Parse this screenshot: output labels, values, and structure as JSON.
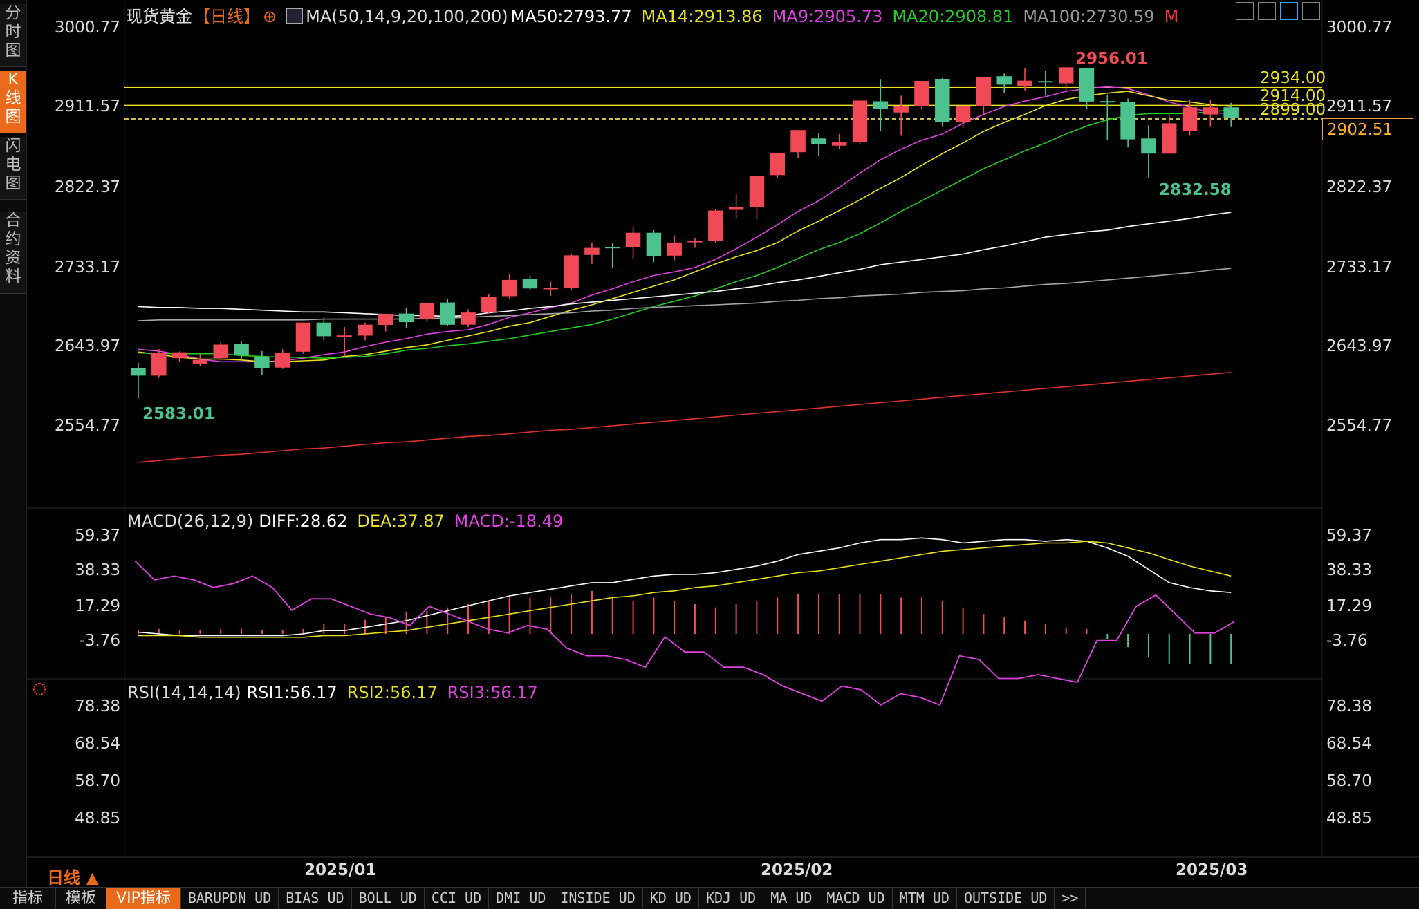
{
  "sidebar": {
    "tabs": [
      "分时图",
      "K线图",
      "闪电图",
      "合约资料"
    ],
    "active": 1
  },
  "header": {
    "symbol": "现货黄金",
    "period": "【日线】",
    "ma_params": "MA(50,14,9,20,100,200)",
    "ma50": "MA50:2793.77",
    "ma14": "MA14:2913.86",
    "ma9": "MA9:2905.73",
    "ma20": "MA20:2908.81",
    "ma100": "MA100:2730.59",
    "m": "M"
  },
  "macd_header": {
    "title": "MACD(26,12,9)",
    "diff": "DIFF:28.62",
    "dea": "DEA:37.87",
    "macd": "MACD:-18.49"
  },
  "rsi_header": {
    "title": "RSI(14,14,14)",
    "rsi1": "RSI1:56.17",
    "rsi2": "RSI2:56.17",
    "rsi3": "RSI3:56.17"
  },
  "price_axis": [
    "3000.77",
    "2911.57",
    "2822.37",
    "2733.17",
    "2643.97",
    "2554.77"
  ],
  "macd_axis": [
    "59.37",
    "38.33",
    "17.29",
    "-3.76"
  ],
  "rsi_axis": [
    "78.38",
    "68.54",
    "58.70",
    "48.85"
  ],
  "x_labels": [
    "2025/01",
    "2025/02",
    "2025/03"
  ],
  "period_label": "日线 ▲",
  "current_price": "2902.51",
  "price_lines": [
    {
      "label": "2934.00",
      "value": 2934.0,
      "style": "solid"
    },
    {
      "label": "2914.00",
      "value": 2914.0,
      "style": "solid"
    },
    {
      "label": "2899.00",
      "value": 2899.0,
      "style": "dashed"
    }
  ],
  "annotations": {
    "high": "2956.01",
    "low_recent": "2832.58",
    "low_start": "2583.01"
  },
  "bottom_tabs": [
    "指标",
    "模板",
    "VIP指标",
    "BARUPDN_UD",
    "BIAS_UD",
    "BOLL_UD",
    "CCI_UD",
    "DMI_UD",
    "INSIDE_UD",
    "KD_UD",
    "KDJ_UD",
    "MA_UD",
    "MACD_UD",
    "MTM_UD",
    "OUTSIDE_UD",
    ">>"
  ],
  "bottom_active": 2,
  "colors": {
    "up": "#f24957",
    "down": "#4cc28f",
    "ma9": "#e040e0",
    "ma14": "#e8e020",
    "ma20": "#22cc22",
    "ma50": "#ffffff",
    "ma100": "#a8a8a8",
    "ma200": "#e03030",
    "orange": "#e86a1a"
  },
  "chart_data": {
    "type": "candlestick",
    "price_range": [
      2554.77,
      3000.77
    ],
    "candles": [
      [
        2618.6,
        2624.8,
        2585.0,
        2610.4
      ],
      [
        2610.4,
        2640.2,
        2608.0,
        2636.0
      ],
      [
        2630.0,
        2637.5,
        2626.0,
        2636.6
      ],
      [
        2624.0,
        2634.5,
        2621.0,
        2628.2
      ],
      [
        2630.0,
        2648.0,
        2628.0,
        2645.3
      ],
      [
        2646.1,
        2649.0,
        2628.0,
        2633.4
      ],
      [
        2631.0,
        2638.0,
        2611.0,
        2618.5
      ],
      [
        2619.5,
        2640.0,
        2618.0,
        2635.9
      ],
      [
        2637.3,
        2670.0,
        2635.0,
        2670.0
      ],
      [
        2670.0,
        2675.0,
        2650.0,
        2654.7
      ],
      [
        2655.0,
        2665.0,
        2632.0,
        2655.6
      ],
      [
        2655.4,
        2670.0,
        2650.0,
        2667.7
      ],
      [
        2667.4,
        2680.0,
        2660.0,
        2679.8
      ],
      [
        2680.2,
        2687.0,
        2664.0,
        2670.5
      ],
      [
        2673.6,
        2692.0,
        2671.0,
        2692.0
      ],
      [
        2692.6,
        2697.0,
        2666.0,
        2667.6
      ],
      [
        2667.7,
        2685.0,
        2665.0,
        2681.3
      ],
      [
        2681.3,
        2702.0,
        2680.0,
        2699.0
      ],
      [
        2699.7,
        2725.0,
        2697.0,
        2718.0
      ],
      [
        2719.2,
        2723.0,
        2707.0,
        2708.4
      ],
      [
        2708.1,
        2716.0,
        2700.0,
        2709.0
      ],
      [
        2709.3,
        2747.0,
        2706.0,
        2745.6
      ],
      [
        2746.1,
        2760.0,
        2736.0,
        2754.0
      ],
      [
        2755.1,
        2760.0,
        2732.0,
        2754.7
      ],
      [
        2754.9,
        2778.0,
        2742.0,
        2771.0
      ],
      [
        2771.0,
        2774.0,
        2738.0,
        2744.8
      ],
      [
        2745.3,
        2768.0,
        2740.0,
        2760.0
      ],
      [
        2760.6,
        2765.0,
        2754.0,
        2761.8
      ],
      [
        2761.8,
        2798.0,
        2759.0,
        2796.0
      ],
      [
        2796.8,
        2815.0,
        2787.0,
        2800.0
      ],
      [
        2799.9,
        2827.0,
        2786.0,
        2834.9
      ],
      [
        2835.8,
        2860.0,
        2833.0,
        2861.0
      ],
      [
        2861.5,
        2880.0,
        2855.0,
        2886.4
      ],
      [
        2877.0,
        2883.0,
        2857.0,
        2870.3
      ],
      [
        2868.9,
        2882.0,
        2865.0,
        2873.1
      ],
      [
        2873.1,
        2912.0,
        2870.0,
        2919.6
      ],
      [
        2918.8,
        2943.0,
        2885.0,
        2909.9
      ],
      [
        2906.2,
        2925.0,
        2880.0,
        2913.2
      ],
      [
        2912.9,
        2936.0,
        2910.0,
        2941.7
      ],
      [
        2943.7,
        2945.0,
        2890.0,
        2895.6
      ],
      [
        2895.0,
        2906.0,
        2889.0,
        2913.5
      ],
      [
        2913.8,
        2940.0,
        2903.0,
        2946.4
      ],
      [
        2947.0,
        2950.0,
        2928.0,
        2937.5
      ],
      [
        2935.8,
        2956.0,
        2931.0,
        2942.0
      ],
      [
        2941.5,
        2953.0,
        2925.0,
        2940.0
      ],
      [
        2939.0,
        2952.0,
        2930.0,
        2957.0
      ],
      [
        2956.0,
        2956.01,
        2910.0,
        2918.5
      ],
      [
        2919.0,
        2926.0,
        2875.0,
        2918.0
      ],
      [
        2918.0,
        2922.0,
        2867.0,
        2876.0
      ],
      [
        2877.0,
        2892.0,
        2832.58,
        2860.0
      ],
      [
        2859.9,
        2904.0,
        2860.0,
        2894.0
      ],
      [
        2885.0,
        2920.0,
        2880.0,
        2912.0
      ],
      [
        2904.0,
        2920.0,
        2890.0,
        2912.0
      ],
      [
        2912.0,
        2917.0,
        2890.0,
        2900.0
      ]
    ],
    "ma_series": [
      {
        "name": "MA9",
        "values": [
          2640,
          2638,
          2634,
          2629,
          2626,
          2626,
          2626,
          2627,
          2630,
          2634,
          2637,
          2643,
          2648,
          2652,
          2657,
          2660,
          2662,
          2668,
          2676,
          2681,
          2687,
          2692,
          2701,
          2708,
          2716,
          2723,
          2727,
          2732,
          2741,
          2753,
          2766,
          2780,
          2795,
          2807,
          2822,
          2838,
          2853,
          2865,
          2875,
          2882,
          2894,
          2904,
          2913,
          2919,
          2924,
          2930,
          2933,
          2935,
          2933,
          2926,
          2918,
          2912,
          2906,
          2905
        ]
      },
      {
        "name": "MA14",
        "values": [
          2637,
          2634,
          2631,
          2629,
          2629,
          2628,
          2626,
          2626,
          2627,
          2628,
          2632,
          2634,
          2638,
          2642,
          2645,
          2650,
          2655,
          2660,
          2666,
          2670,
          2677,
          2684,
          2690,
          2697,
          2704,
          2711,
          2718,
          2727,
          2736,
          2744,
          2751,
          2760,
          2773,
          2784,
          2796,
          2808,
          2821,
          2833,
          2847,
          2860,
          2872,
          2885,
          2895,
          2904,
          2914,
          2921,
          2925,
          2928,
          2930,
          2925,
          2920,
          2918,
          2915,
          2913
        ]
      },
      {
        "name": "MA20",
        "values": [
          2636,
          2635,
          2635,
          2635,
          2635,
          2633,
          2632,
          2631,
          2631,
          2630,
          2631,
          2632,
          2635,
          2639,
          2641,
          2644,
          2646,
          2649,
          2652,
          2656,
          2660,
          2664,
          2668,
          2674,
          2681,
          2688,
          2694,
          2700,
          2708,
          2716,
          2723,
          2732,
          2742,
          2752,
          2760,
          2770,
          2782,
          2795,
          2807,
          2819,
          2831,
          2843,
          2853,
          2863,
          2872,
          2882,
          2891,
          2898,
          2903,
          2905,
          2905,
          2905,
          2907,
          2909
        ]
      },
      {
        "name": "MA50",
        "values": [
          2688,
          2687,
          2687,
          2686,
          2686,
          2685,
          2684,
          2683,
          2682,
          2682,
          2681,
          2680,
          2679,
          2678,
          2678,
          2677,
          2678,
          2681,
          2683,
          2686,
          2688,
          2691,
          2693,
          2695,
          2697,
          2699,
          2701,
          2703,
          2705,
          2708,
          2711,
          2715,
          2718,
          2722,
          2726,
          2730,
          2735,
          2738,
          2741,
          2744,
          2747,
          2752,
          2756,
          2761,
          2766,
          2769,
          2772,
          2774,
          2778,
          2781,
          2784,
          2787,
          2791,
          2794
        ]
      },
      {
        "name": "MA100",
        "values": [
          2672,
          2673,
          2673,
          2673,
          2673,
          2673,
          2673,
          2673,
          2673,
          2674,
          2674,
          2674,
          2674,
          2674,
          2675,
          2675,
          2676,
          2677,
          2678,
          2679,
          2680,
          2681,
          2683,
          2684,
          2686,
          2687,
          2688,
          2689,
          2690,
          2691,
          2692,
          2694,
          2695,
          2697,
          2698,
          2700,
          2701,
          2702,
          2704,
          2705,
          2706,
          2708,
          2709,
          2711,
          2713,
          2714,
          2716,
          2718,
          2720,
          2722,
          2724,
          2726,
          2729,
          2731
        ]
      },
      {
        "name": "MA200",
        "values": [
          2513,
          2515,
          2517,
          2519,
          2521,
          2522,
          2524,
          2526,
          2528,
          2529,
          2531,
          2533,
          2535,
          2536,
          2538,
          2540,
          2542,
          2543,
          2545,
          2547,
          2549,
          2550,
          2552,
          2554,
          2556,
          2558,
          2560,
          2562,
          2564,
          2566,
          2568,
          2570,
          2572,
          2574,
          2576,
          2578,
          2580,
          2582,
          2584,
          2586,
          2588,
          2590,
          2592,
          2594,
          2596,
          2598,
          2600,
          2602,
          2604,
          2606,
          2608,
          2610,
          2612,
          2614
        ]
      }
    ],
    "macd": {
      "range": [
        -3.76,
        59.37
      ],
      "diff": [
        1,
        0,
        -1,
        -1,
        -1,
        -1,
        -1,
        -1,
        0,
        2,
        2,
        4,
        6,
        8,
        11,
        14,
        17,
        20,
        23,
        25,
        27,
        29,
        31,
        31,
        33,
        35,
        36,
        36,
        37,
        39,
        41,
        44,
        48,
        50,
        52,
        55,
        57,
        57,
        58,
        57,
        55,
        56,
        57,
        57,
        56,
        57,
        56,
        52,
        47,
        39,
        31,
        28,
        26,
        25
      ],
      "dea": [
        -1,
        -1,
        -1,
        -2,
        -2,
        -2,
        -2,
        -2,
        -2,
        -1,
        -1,
        0,
        1,
        2,
        4,
        6,
        8,
        10,
        12,
        14,
        16,
        18,
        20,
        22,
        23,
        25,
        26,
        28,
        29,
        31,
        33,
        35,
        37,
        38,
        40,
        42,
        44,
        46,
        48,
        50,
        51,
        52,
        53,
        54,
        55,
        55,
        56,
        55,
        52,
        49,
        45,
        41,
        38,
        35
      ],
      "hist": [
        2.5,
        3.0,
        2.0,
        2.5,
        3.0,
        3.0,
        2.5,
        2.5,
        3.0,
        6.0,
        6.0,
        8.5,
        10.0,
        13.0,
        14.0,
        16.0,
        18.0,
        20.0,
        22.0,
        22.0,
        22.0,
        24.0,
        26.0,
        22.0,
        20.0,
        22.0,
        20.0,
        18.0,
        16.0,
        18.0,
        20.0,
        22.0,
        24.0,
        24.0,
        24.0,
        24.0,
        24.0,
        22.0,
        22.0,
        20.0,
        16.0,
        12.0,
        10.0,
        8.0,
        6.0,
        4.0,
        3.0,
        -3.0,
        -8.0,
        -14.0,
        -18.0,
        -18.0,
        -18.0,
        -18.0
      ]
    },
    "rsi": {
      "range": [
        48.85,
        78.38
      ],
      "values": [
        40,
        45,
        44,
        45,
        47,
        46,
        44,
        47,
        53,
        50,
        50,
        52,
        54,
        55,
        57,
        52,
        54,
        56,
        58,
        59,
        57,
        58,
        63,
        65,
        65,
        66,
        68,
        60,
        64,
        64,
        68,
        68,
        70,
        73,
        75,
        77,
        73,
        74,
        78,
        75,
        76,
        78,
        65,
        66,
        71,
        71,
        70,
        71,
        72,
        61,
        61,
        52,
        49,
        54,
        59,
        59,
        56
      ]
    }
  }
}
